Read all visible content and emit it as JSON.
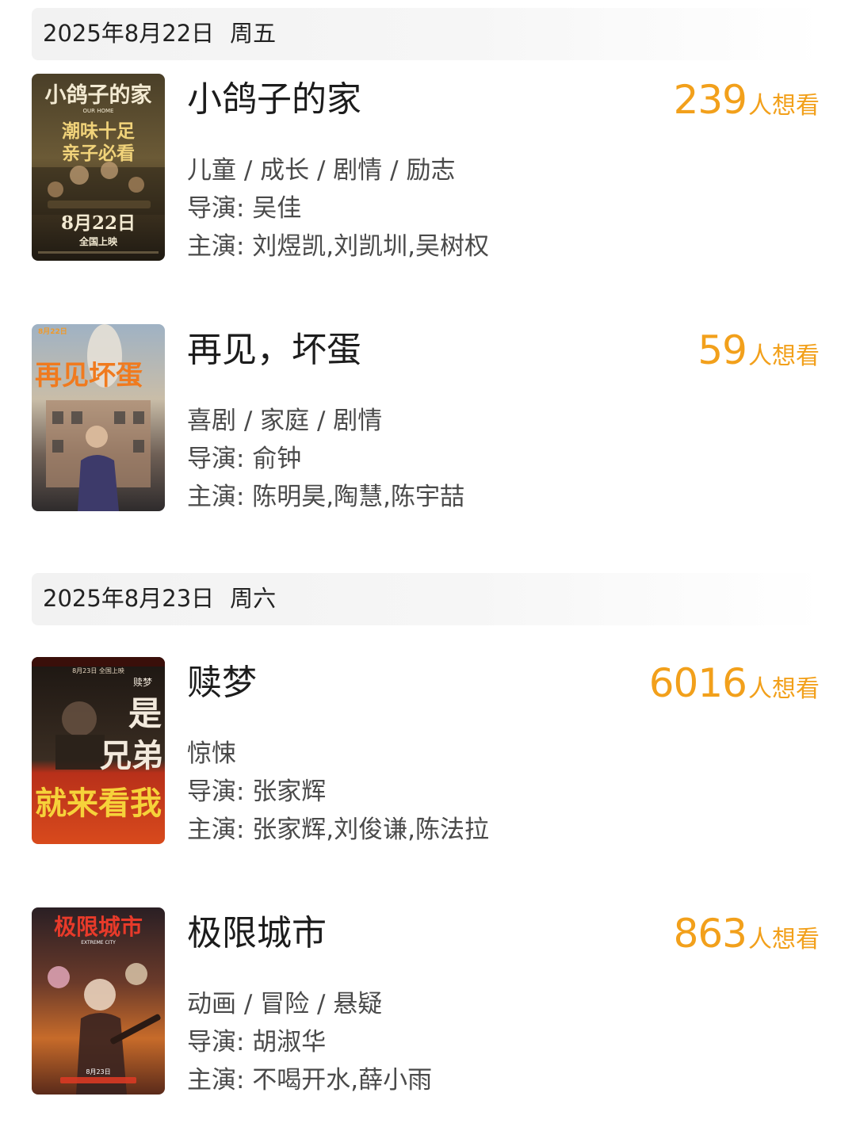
{
  "days": [
    {
      "date": "2025年8月22日",
      "weekday": "周五",
      "movies": [
        {
          "title": "小鸽子的家",
          "want_count": "239",
          "want_unit": "人想看",
          "genres": "儿童 / 成长 / 剧情 / 励志",
          "director": "导演: 吴佳",
          "cast": "主演: 刘煜凯,刘凯圳,吴树权",
          "poster": {
            "icon": "movie-poster-image",
            "title_text": "小鸽子的家",
            "subtitle_text": "OUR HOME",
            "tagline_1": "潮味十足",
            "tagline_2": "亲子必看",
            "release": "8月22日",
            "release_note": "全国上映",
            "colors": [
              "#3a3322",
              "#6b5a36",
              "#1f1a12"
            ]
          }
        },
        {
          "title": "再见，坏蛋",
          "want_count": "59",
          "want_unit": "人想看",
          "genres": "喜剧 / 家庭 / 剧情",
          "director": "导演: 俞钟",
          "cast": "主演: 陈明昊,陶慧,陈宇喆",
          "poster": {
            "icon": "movie-poster-image",
            "title_text": "再见坏蛋",
            "top_text": "8月22日",
            "colors": [
              "#8ea3b8",
              "#c7b8a0",
              "#3b3a3a"
            ]
          }
        }
      ]
    },
    {
      "date": "2025年8月23日",
      "weekday": "周六",
      "movies": [
        {
          "title": "赎梦",
          "want_count": "6016",
          "want_unit": "人想看",
          "genres": "惊悚",
          "director": "导演: 张家辉",
          "cast": "主演: 张家辉,刘俊谦,陈法拉",
          "poster": {
            "icon": "movie-poster-image",
            "top_text": "8月23日 全国上映",
            "text_1": "是",
            "text_2": "兄弟",
            "text_3": "就来看我",
            "logo": "赎梦",
            "colors": [
              "#1c1612",
              "#3a2d22",
              "#c5361a"
            ]
          }
        },
        {
          "title": "极限城市",
          "want_count": "863",
          "want_unit": "人想看",
          "genres": "动画 / 冒险 / 悬疑",
          "director": "导演: 胡淑华",
          "cast": "主演: 不喝开水,薛小雨",
          "poster": {
            "icon": "movie-poster-image",
            "title_text": "极限城市",
            "subtitle_text": "EXTREME CITY",
            "release": "8月23日",
            "colors": [
              "#2a1f24",
              "#c76b2a",
              "#5a2a1a"
            ]
          }
        }
      ]
    }
  ]
}
